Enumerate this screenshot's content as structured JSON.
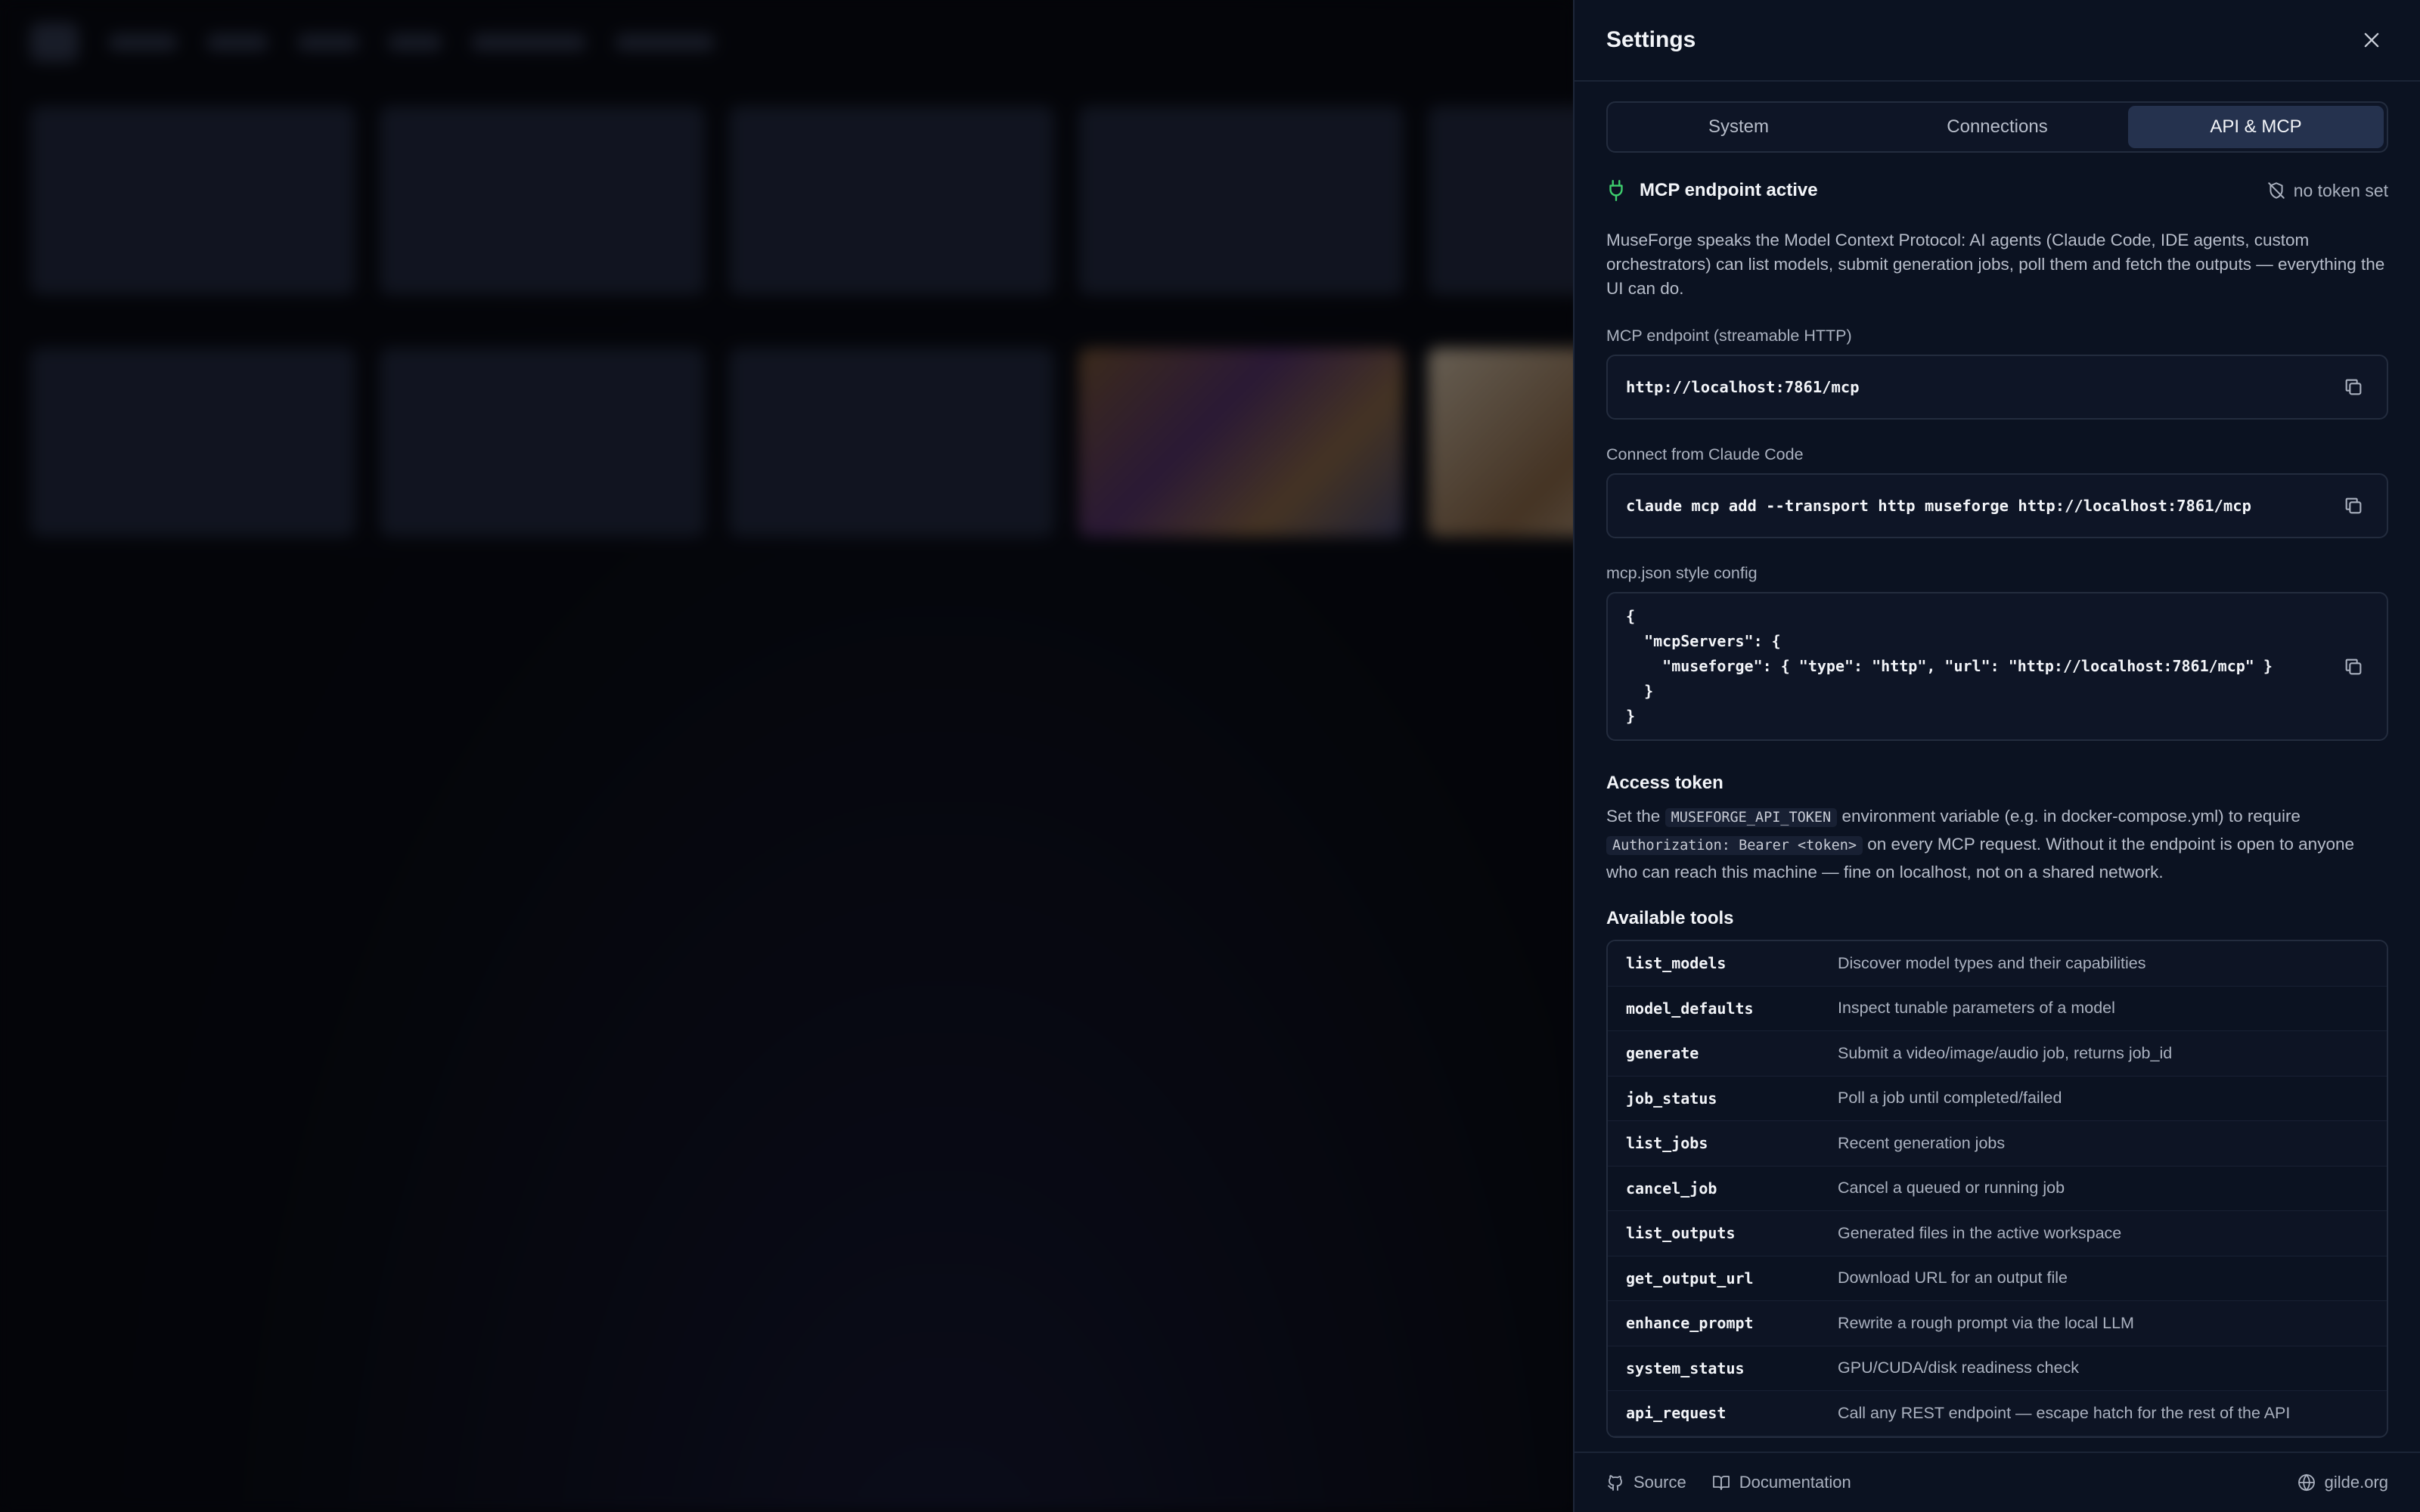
{
  "colors": {
    "accent_green": "#3ecf6e",
    "panel_bg": "#0b1221",
    "tab_active_bg": "#25324e",
    "text_primary": "#f2f4f8",
    "text_muted": "#aab1bf"
  },
  "settings": {
    "title": "Settings",
    "close_icon": "close-icon",
    "tabs": [
      {
        "label": "System",
        "active": false
      },
      {
        "label": "Connections",
        "active": false
      },
      {
        "label": "API & MCP",
        "active": true
      }
    ],
    "status": {
      "icon": "plug-icon",
      "text": "MCP endpoint active",
      "token_icon": "shield-off-icon",
      "token_text": "no token set"
    },
    "description": "MuseForge speaks the Model Context Protocol: AI agents (Claude Code, IDE agents, custom orchestrators) can list models, submit generation jobs, poll them and fetch the outputs — everything the UI can do.",
    "endpoint": {
      "label": "MCP endpoint (streamable HTTP)",
      "value": "http://localhost:7861/mcp"
    },
    "claude_code": {
      "label": "Connect from Claude Code",
      "value": "claude mcp add --transport http museforge http://localhost:7861/mcp"
    },
    "json_config": {
      "label": "mcp.json style config",
      "value": "{\n  \"mcpServers\": {\n    \"museforge\": { \"type\": \"http\", \"url\": \"http://localhost:7861/mcp\" }\n  }\n}"
    },
    "access_token": {
      "title": "Access token",
      "text_1": "Set the ",
      "env_var": "MUSEFORGE_API_TOKEN",
      "text_2": " environment variable (e.g. in docker-compose.yml) to require ",
      "header": "Authorization: Bearer <token>",
      "text_3": " on every MCP request. Without it the endpoint is open to anyone who can reach this machine — fine on localhost, not on a shared network."
    },
    "tools": {
      "title": "Available tools",
      "items": [
        {
          "name": "list_models",
          "desc": "Discover model types and their capabilities"
        },
        {
          "name": "model_defaults",
          "desc": "Inspect tunable parameters of a model"
        },
        {
          "name": "generate",
          "desc": "Submit a video/image/audio job, returns job_id"
        },
        {
          "name": "job_status",
          "desc": "Poll a job until completed/failed"
        },
        {
          "name": "list_jobs",
          "desc": "Recent generation jobs"
        },
        {
          "name": "cancel_job",
          "desc": "Cancel a queued or running job"
        },
        {
          "name": "list_outputs",
          "desc": "Generated files in the active workspace"
        },
        {
          "name": "get_output_url",
          "desc": "Download URL for an output file"
        },
        {
          "name": "enhance_prompt",
          "desc": "Rewrite a rough prompt via the local LLM"
        },
        {
          "name": "system_status",
          "desc": "GPU/CUDA/disk readiness check"
        },
        {
          "name": "api_request",
          "desc": "Call any REST endpoint — escape hatch for the rest of the API"
        }
      ]
    },
    "footer": {
      "source_label": "Source",
      "docs_label": "Documentation",
      "site_label": "gilde.org"
    }
  }
}
